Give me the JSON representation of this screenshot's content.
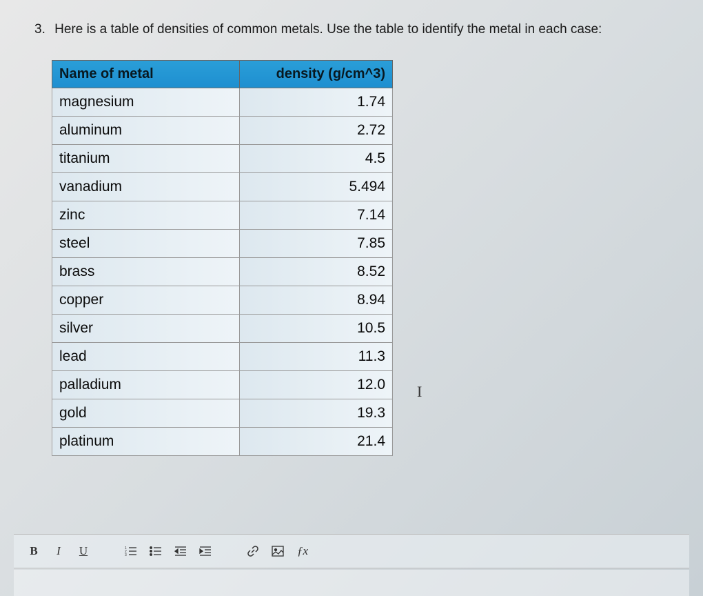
{
  "question": {
    "number": "3.",
    "text": "Here is a table of densities of common metals. Use the table to identify the metal in each case:"
  },
  "table": {
    "headers": {
      "name": "Name of metal",
      "density": "density (g/cm^3)"
    },
    "rows": [
      {
        "name": "magnesium",
        "density": "1.74"
      },
      {
        "name": "aluminum",
        "density": "2.72"
      },
      {
        "name": "titanium",
        "density": "4.5"
      },
      {
        "name": "vanadium",
        "density": "5.494"
      },
      {
        "name": "zinc",
        "density": "7.14"
      },
      {
        "name": "steel",
        "density": "7.85"
      },
      {
        "name": "brass",
        "density": "8.52"
      },
      {
        "name": "copper",
        "density": "8.94"
      },
      {
        "name": "silver",
        "density": "10.5"
      },
      {
        "name": "lead",
        "density": "11.3"
      },
      {
        "name": "palladium",
        "density": "12.0"
      },
      {
        "name": "gold",
        "density": "19.3"
      },
      {
        "name": "platinum",
        "density": "21.4"
      }
    ]
  },
  "toolbar": {
    "bold": "B",
    "italic": "I",
    "underline": "U",
    "fx": "ƒx"
  },
  "cursor": "I"
}
